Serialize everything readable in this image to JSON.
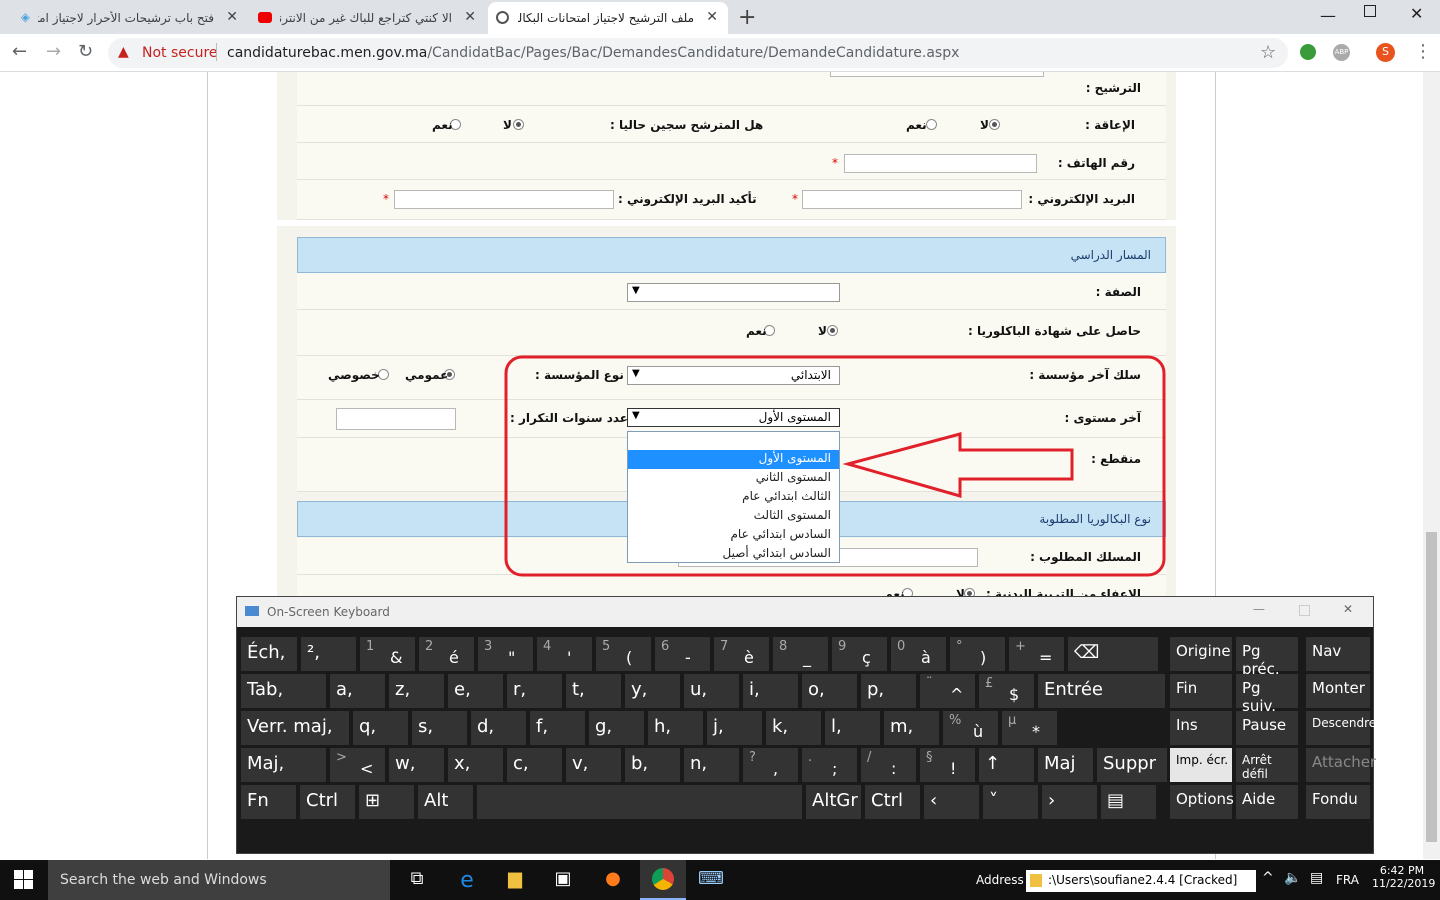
{
  "browser": {
    "tabs": [
      {
        "title": "فتح باب ترشيحات الأحرار لاجتياز امتحـ",
        "active": false
      },
      {
        "title": "الا كنتي كتراجع للباك غير من الانترنـ",
        "active": false
      },
      {
        "title": "ملف الترشيح لاجتياز امتحانات البكالـ",
        "active": true
      }
    ],
    "security_label": "Not secure",
    "url_host": "candidaturebac.men.gov.ma",
    "url_path": "/CandidatBac/Pages/Bac/DemandesCandidature/DemandeCandidature.aspx",
    "new_tab": "+",
    "close_glyph": "✕"
  },
  "form": {
    "candidature_label": "الترشيح :",
    "handicap_label": "الإعاقة :",
    "no": "لا",
    "yes": "نعم",
    "prisoner_label": "هل المترشح سجين حاليا :",
    "phone_label": "رقم الهاتف :",
    "email_label": "البريد الإلكتروني :",
    "email_confirm_label": "تأكيد البريد الإلكتروني :",
    "required": "*",
    "section_path": "المسار الدراسي",
    "sifa_label": "الصفة :",
    "bac_holder_label": "حاصل على شهادة الباكلوريا :",
    "last_cycle_label": "سلك آخر مؤسسة :",
    "last_cycle_value": "الابتدائي",
    "institution_type_label": "نوع المؤسسة :",
    "public": "عمومي",
    "private": "خصوصي",
    "last_level_label": "آخر مستوى :",
    "last_level_value": "المستوى الأول",
    "repeat_years_label": "عدد سنوات التكرار :",
    "dropout_label": "منقطع :",
    "section_bac_type": "نوع البكالوريا المطلوبة",
    "track_label": "المسلك المطلوب :",
    "exempt_label": "الإعفاء من التربية البدنية :",
    "dropdown_options": [
      "",
      "المستوى الأول",
      "المستوى الثاني",
      "الثالث ابتدائي عام",
      "المستوى الثالث",
      "السادس ابتدائي عام",
      "السادس ابتدائي أصيل"
    ],
    "dropdown_selected_index": 1
  },
  "osk": {
    "title": "On-Screen Keyboard",
    "row1": [
      [
        "Éch",
        ""
      ],
      [
        "²",
        ""
      ],
      [
        "&",
        "1"
      ],
      [
        "é",
        "2"
      ],
      [
        "\"",
        "3"
      ],
      [
        "'",
        "4"
      ],
      [
        "(",
        "5"
      ],
      [
        "-",
        "6"
      ],
      [
        "è",
        "7"
      ],
      [
        "_",
        "8"
      ],
      [
        "ç",
        "9"
      ],
      [
        "à",
        "0"
      ],
      [
        ")",
        "°"
      ],
      [
        "=",
        "+"
      ]
    ],
    "row2": [
      [
        "Tab",
        ""
      ],
      [
        "a",
        ""
      ],
      [
        "z",
        ""
      ],
      [
        "e",
        ""
      ],
      [
        "r",
        ""
      ],
      [
        "t",
        ""
      ],
      [
        "y",
        ""
      ],
      [
        "u",
        ""
      ],
      [
        "i",
        ""
      ],
      [
        "o",
        ""
      ],
      [
        "p",
        ""
      ],
      [
        "^",
        "¨"
      ],
      [
        "$",
        "£"
      ]
    ],
    "row3": [
      [
        "Verr. maj",
        ""
      ],
      [
        "q",
        ""
      ],
      [
        "s",
        ""
      ],
      [
        "d",
        ""
      ],
      [
        "f",
        ""
      ],
      [
        "g",
        ""
      ],
      [
        "h",
        ""
      ],
      [
        "j",
        ""
      ],
      [
        "k",
        ""
      ],
      [
        "l",
        ""
      ],
      [
        "m",
        ""
      ],
      [
        "ù",
        "%"
      ],
      [
        "*",
        "µ"
      ]
    ],
    "row4": [
      [
        "Maj",
        ""
      ],
      [
        "<",
        ">"
      ],
      [
        "w",
        ""
      ],
      [
        "x",
        ""
      ],
      [
        "c",
        ""
      ],
      [
        "v",
        ""
      ],
      [
        "b",
        ""
      ],
      [
        "n",
        ""
      ],
      [
        ",",
        "?"
      ],
      [
        ";",
        "."
      ],
      [
        ":",
        "/"
      ],
      [
        "!",
        "§"
      ]
    ],
    "entree": "Entrée",
    "maj_right": "Maj",
    "suppr": "Suppr",
    "fn": "Fn",
    "ctrl": "Ctrl",
    "alt": "Alt",
    "altgr": "AltGr",
    "ctrl_right": "Ctrl",
    "nav": [
      [
        "Origine",
        "Pg préc.",
        "Nav"
      ],
      [
        "Fin",
        "Pg suiv.",
        "Monter"
      ],
      [
        "Ins",
        "Pause",
        "Descendre"
      ],
      [
        "Imp. écr.",
        "Arrêt défil",
        "Attacher"
      ],
      [
        "Options",
        "Aide",
        "Fondu"
      ]
    ]
  },
  "taskbar": {
    "search": "Search the web and Windows",
    "address_label": "Address",
    "address_value": ":\\Users\\soufiane2.4.4 [Cracked]",
    "lang": "FRA",
    "time": "6:42 PM",
    "date": "11/22/2019"
  }
}
